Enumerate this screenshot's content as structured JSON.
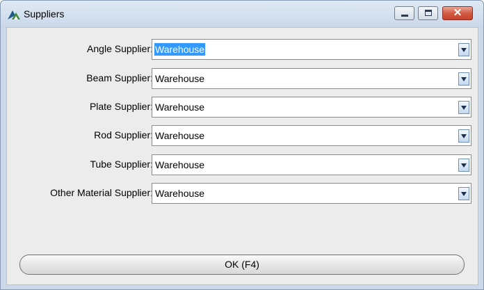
{
  "window": {
    "title": "Suppliers",
    "app_icon": "tekla-logo-icon",
    "controls": {
      "minimize": "minimize-icon",
      "maximize": "maximize-icon",
      "close": "✕"
    }
  },
  "fields": [
    {
      "label": "Angle Supplier:",
      "value": "Warehouse",
      "selected": true
    },
    {
      "label": "Beam Supplier:",
      "value": "Warehouse",
      "selected": false
    },
    {
      "label": "Plate Supplier:",
      "value": "Warehouse",
      "selected": false
    },
    {
      "label": "Rod Supplier:",
      "value": "Warehouse",
      "selected": false
    },
    {
      "label": "Tube Supplier:",
      "value": "Warehouse",
      "selected": false
    },
    {
      "label": "Other Material Supplier:",
      "value": "Warehouse",
      "selected": false
    }
  ],
  "ok_button": {
    "label": "OK (F4)"
  },
  "colors": {
    "selection": "#3399ff",
    "close_button": "#c7402b",
    "client_background": "#ececec"
  }
}
